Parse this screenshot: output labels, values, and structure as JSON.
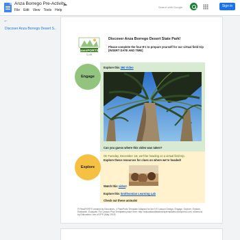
{
  "app": {
    "title": "Anza Borrego Pre-Activity",
    "menu": [
      "File",
      "Edit",
      "View",
      "Tools",
      "Help"
    ],
    "search_placeholder": "Search with Google",
    "signin_label": "Sign in",
    "accent": "#1a73e8"
  },
  "outline": {
    "items": [
      "Discover Anza Borrego Desert S..."
    ]
  },
  "doc": {
    "heading": "Discover Anza Borrego Desert State Park!",
    "intro": "Please complete the four E's to prepare yourself for our virtual field trip [INSERT DATE AND TIME]",
    "logo_text": "passPORTS",
    "logo_sub": "CLUB",
    "engage": {
      "label": "Engage",
      "explore_prefix": "Explore this ",
      "video_link": "360 Video",
      "question": "Can you guess where this video was taken?",
      "color": "#93c47d"
    },
    "explore": {
      "label": "Explore",
      "line1": "On Tuesday, December 1st, we'll be heading on a virtual field trip.",
      "line2": "Explore these resources for clues on where we're headed!",
      "watch_prefix": "Watch this ",
      "video_link": "video",
      "watch_suffix": "!",
      "lab_prefix": "Explore this ",
      "lab_link": "Smithsonian Learning Lab",
      "check": "Check out these animals!",
      "color": "#f6c142"
    },
    "footnote": "® PassPORTS created by Educators. 4 PassPorts Template Adapted for the 5 E Lesson Design. Engage, Explore, Explain, Elaborate, Evaluate. For Lesson Plan Templates place here: http://educationalleadershiptemplates.wordpress.com, shared at by Educators / Are of ZPS (May 2019)"
  }
}
